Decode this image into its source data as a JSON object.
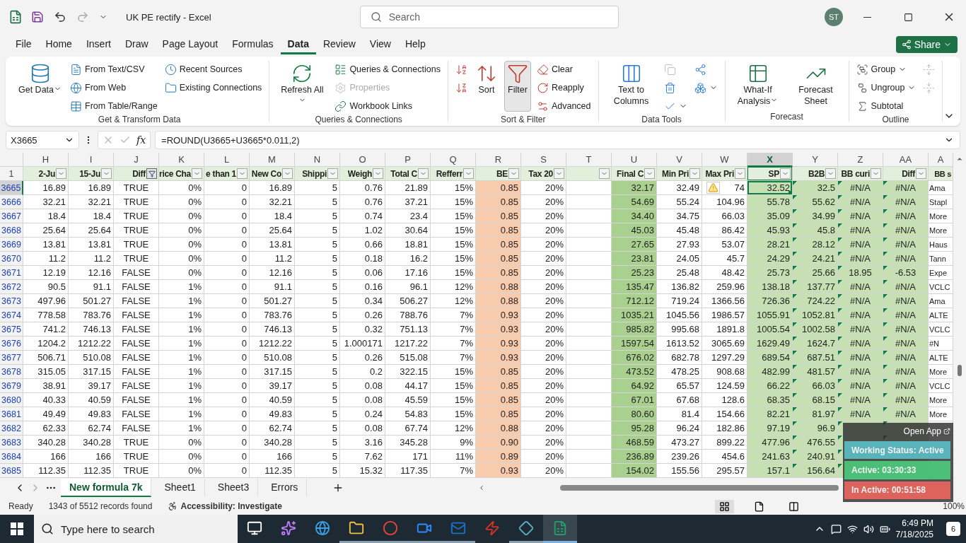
{
  "title_bar": {
    "document_title": "UK PE rectify  -  Excel",
    "search_placeholder": "Search",
    "avatar": "ST"
  },
  "menu_tabs": [
    {
      "label": "File",
      "selected": false
    },
    {
      "label": "Home",
      "selected": false
    },
    {
      "label": "Insert",
      "selected": false
    },
    {
      "label": "Draw",
      "selected": false
    },
    {
      "label": "Page Layout",
      "selected": false
    },
    {
      "label": "Formulas",
      "selected": false
    },
    {
      "label": "Data",
      "selected": true
    },
    {
      "label": "Review",
      "selected": false
    },
    {
      "label": "View",
      "selected": false
    },
    {
      "label": "Help",
      "selected": false
    }
  ],
  "share_button": "Share",
  "ribbon": [
    {
      "label": "Get & Transform Data",
      "columns": [
        {
          "kind": "large",
          "label": "Get Data",
          "menu": true
        },
        {
          "kind": "stack",
          "items": [
            {
              "label": "From Text/CSV",
              "disabled": false
            },
            {
              "label": "From Web",
              "disabled": false
            },
            {
              "label": "From Table/Range",
              "disabled": false
            }
          ]
        },
        {
          "kind": "stack",
          "items": [
            {
              "label": "Recent Sources",
              "disabled": false
            },
            {
              "label": "Existing Connections",
              "disabled": false
            }
          ]
        }
      ]
    },
    {
      "label": "Queries & Connections",
      "columns": [
        {
          "kind": "large",
          "label": "Refresh All",
          "menu": true
        },
        {
          "kind": "stack",
          "items": [
            {
              "label": "Queries & Connections",
              "disabled": false
            },
            {
              "label": "Properties",
              "disabled": true
            },
            {
              "label": "Workbook Links",
              "disabled": false
            }
          ]
        }
      ]
    },
    {
      "label": "Sort & Filter",
      "columns": [
        {
          "kind": "stack",
          "items": [
            {
              "disabled": false
            },
            {
              "disabled": false
            }
          ]
        },
        {
          "kind": "large",
          "label": "Sort",
          "menu": false
        },
        {
          "kind": "large",
          "label": "Filter",
          "menu": false,
          "selected": true
        },
        {
          "kind": "stack",
          "items": [
            {
              "label": "Clear",
              "disabled": false
            },
            {
              "label": "Reapply",
              "disabled": false
            },
            {
              "label": "Advanced",
              "disabled": false
            }
          ]
        }
      ]
    },
    {
      "label": "Data Tools",
      "columns": [
        {
          "kind": "large",
          "label": "Text to Columns",
          "menu": false
        },
        {
          "kind": "stack",
          "items": [
            {
              "disabled": true
            },
            {
              "disabled": false
            },
            {
              "disabled": false,
              "menu": true
            }
          ]
        },
        {
          "kind": "stack",
          "items": [
            {
              "disabled": false
            },
            {
              "disabled": false,
              "menu": true
            }
          ]
        }
      ]
    },
    {
      "label": "Forecast",
      "columns": [
        {
          "kind": "large",
          "label": "What-If Analysis",
          "menu": true
        },
        {
          "kind": "large",
          "label": "Forecast Sheet",
          "menu": false
        }
      ]
    },
    {
      "label": "Outline",
      "columns": [
        {
          "kind": "stack",
          "items": [
            {
              "label": "Group",
              "disabled": false,
              "menu": true
            },
            {
              "label": "Ungroup",
              "disabled": false,
              "menu": true
            },
            {
              "label": "Subtotal",
              "disabled": false
            }
          ]
        },
        {
          "kind": "stack",
          "items": [
            {
              "disabled": true
            },
            {
              "disabled": true
            }
          ]
        }
      ]
    }
  ],
  "formula_bar": {
    "name_box": "X3665",
    "fx": "fx",
    "formula": "=ROUND(U3665+U3665*0.011,2)"
  },
  "sheet": {
    "header_row_number": "1",
    "error_check_tag": true,
    "columns": [
      {
        "letter": "H",
        "header": "2-Ju",
        "kind": "number",
        "selected": false,
        "filtered": false
      },
      {
        "letter": "I",
        "header": "15-Ju",
        "kind": "number",
        "selected": false,
        "filtered": false
      },
      {
        "letter": "J",
        "header": "Diff",
        "kind": "boolean",
        "selected": false,
        "filtered": true
      },
      {
        "letter": "K",
        "header": "rice Cha",
        "kind": "number",
        "selected": false,
        "filtered": false
      },
      {
        "letter": "L",
        "header": "e than 1",
        "kind": "number",
        "selected": false,
        "filtered": false
      },
      {
        "letter": "M",
        "header": "New Co",
        "kind": "number",
        "selected": false,
        "filtered": false
      },
      {
        "letter": "N",
        "header": "Shippi",
        "kind": "number",
        "selected": false,
        "filtered": false
      },
      {
        "letter": "O",
        "header": "Weigh",
        "kind": "number",
        "selected": false,
        "filtered": false
      },
      {
        "letter": "P",
        "header": "Total C",
        "kind": "number",
        "selected": false,
        "filtered": false
      },
      {
        "letter": "Q",
        "header": "Refferr",
        "kind": "number",
        "selected": false,
        "filtered": false
      },
      {
        "letter": "R",
        "header": "BE",
        "kind": "number",
        "selected": false,
        "filtered": false,
        "color": "#f8cbad"
      },
      {
        "letter": "S",
        "header": "Tax 20",
        "kind": "number",
        "selected": false,
        "filtered": false
      },
      {
        "letter": "T",
        "kind": "number",
        "selected": false,
        "filtered": false
      },
      {
        "letter": "U",
        "header": "Final C",
        "kind": "number",
        "selected": false,
        "filtered": false,
        "color": "#a9d08e"
      },
      {
        "letter": "V",
        "header": "Min Pri",
        "kind": "number",
        "selected": false,
        "filtered": false
      },
      {
        "letter": "W",
        "header": "Max Pri",
        "kind": "number",
        "selected": false,
        "filtered": false
      },
      {
        "letter": "X",
        "header": "SP",
        "kind": "number",
        "selected": true,
        "filtered": false,
        "color": "#c6e0b4"
      },
      {
        "letter": "Y",
        "header": "B2B",
        "kind": "number",
        "selected": false,
        "filtered": false,
        "color": "#c6e0b4",
        "error_indicator": true
      },
      {
        "letter": "Z",
        "header": "BB curi",
        "kind": "lookup",
        "selected": false,
        "filtered": false,
        "color": "#c6e0b4",
        "error_indicator": true
      },
      {
        "letter": "AA",
        "header": "Diff",
        "kind": "lookup",
        "selected": false,
        "filtered": false,
        "color": "#c6e0b4",
        "error_indicator": true
      },
      {
        "letter": "A",
        "header": "BB s",
        "kind": "text",
        "selected": false
      }
    ],
    "rows": [
      {
        "number": "3665",
        "selected": true,
        "cells": [
          "16.89",
          "16.89",
          "TRUE",
          "0%",
          "0",
          "16.89",
          "5",
          "0.76",
          "21.89",
          "15%",
          "0.85",
          "20%",
          null,
          "32.17",
          "32.49",
          "74",
          "32.52",
          "32.5",
          "#N/A",
          "#N/A",
          "Ama"
        ]
      },
      {
        "number": "3666",
        "selected": false,
        "cells": [
          "32.21",
          "32.21",
          "TRUE",
          "0%",
          "0",
          "32.21",
          "5",
          "0.76",
          "37.21",
          "15%",
          "0.85",
          "20%",
          null,
          "54.69",
          "55.24",
          "104.96",
          "55.78",
          "55.62",
          "#N/A",
          "#N/A",
          "Stapl"
        ]
      },
      {
        "number": "3667",
        "selected": false,
        "cells": [
          "18.4",
          "18.4",
          "TRUE",
          "0%",
          "0",
          "18.4",
          "5",
          "0.74",
          "23.4",
          "15%",
          "0.85",
          "20%",
          null,
          "34.40",
          "34.75",
          "66.03",
          "35.09",
          "34.99",
          "#N/A",
          "#N/A",
          "More"
        ]
      },
      {
        "number": "3668",
        "selected": false,
        "cells": [
          "25.64",
          "25.64",
          "TRUE",
          "0%",
          "0",
          "25.64",
          "5",
          "1.02",
          "30.64",
          "15%",
          "0.85",
          "20%",
          null,
          "45.03",
          "45.48",
          "86.42",
          "45.93",
          "45.8",
          "#N/A",
          "#N/A",
          "More"
        ]
      },
      {
        "number": "3669",
        "selected": false,
        "cells": [
          "13.81",
          "13.81",
          "TRUE",
          "0%",
          "0",
          "13.81",
          "5",
          "0.66",
          "18.81",
          "15%",
          "0.85",
          "20%",
          null,
          "27.65",
          "27.93",
          "53.07",
          "28.21",
          "28.12",
          "#N/A",
          "#N/A",
          "Haus"
        ]
      },
      {
        "number": "3670",
        "selected": false,
        "cells": [
          "11.2",
          "11.2",
          "TRUE",
          "0%",
          "0",
          "11.2",
          "5",
          "0.18",
          "16.2",
          "15%",
          "0.85",
          "20%",
          null,
          "23.81",
          "24.05",
          "45.7",
          "24.29",
          "24.21",
          "#N/A",
          "#N/A",
          "Tann"
        ]
      },
      {
        "number": "3671",
        "selected": false,
        "cells": [
          "12.19",
          "12.16",
          "FALSE",
          "0%",
          "0",
          "12.16",
          "5",
          "0.06",
          "17.16",
          "15%",
          "0.85",
          "20%",
          null,
          "25.23",
          "25.48",
          "48.42",
          "25.73",
          "25.66",
          "18.95",
          "-6.53",
          "Expe"
        ]
      },
      {
        "number": "3672",
        "selected": false,
        "cells": [
          "90.5",
          "91.1",
          "FALSE",
          "1%",
          "0",
          "91.1",
          "5",
          "0.16",
          "96.1",
          "12%",
          "0.88",
          "20%",
          null,
          "135.47",
          "136.82",
          "259.96",
          "138.18",
          "137.77",
          "#N/A",
          "#N/A",
          "VCLC"
        ]
      },
      {
        "number": "3673",
        "selected": false,
        "cells": [
          "497.96",
          "501.27",
          "FALSE",
          "1%",
          "0",
          "501.27",
          "5",
          "0.34",
          "506.27",
          "12%",
          "0.88",
          "20%",
          null,
          "712.12",
          "719.24",
          "1366.56",
          "726.36",
          "724.22",
          "#N/A",
          "#N/A",
          "Ama"
        ]
      },
      {
        "number": "3674",
        "selected": false,
        "cells": [
          "778.58",
          "783.76",
          "FALSE",
          "1%",
          "0",
          "783.76",
          "5",
          "0.26",
          "788.76",
          "7%",
          "0.93",
          "20%",
          null,
          "1035.21",
          "1045.56",
          "1986.57",
          "1055.91",
          "1052.81",
          "#N/A",
          "#N/A",
          "ALTE"
        ]
      },
      {
        "number": "3675",
        "selected": false,
        "cells": [
          "741.2",
          "746.13",
          "FALSE",
          "1%",
          "0",
          "746.13",
          "5",
          "0.32",
          "751.13",
          "7%",
          "0.93",
          "20%",
          null,
          "985.82",
          "995.68",
          "1891.8",
          "1005.54",
          "1002.58",
          "#N/A",
          "#N/A",
          "VCLC"
        ]
      },
      {
        "number": "3676",
        "selected": false,
        "cells": [
          "1204.2",
          "1212.22",
          "FALSE",
          "1%",
          "0",
          "1212.22",
          "5",
          "1.000171",
          "1217.22",
          "7%",
          "0.93",
          "20%",
          null,
          "1597.54",
          "1613.52",
          "3065.69",
          "1629.49",
          "1624.7",
          "#N/A",
          "#N/A",
          "#N"
        ]
      },
      {
        "number": "3677",
        "selected": false,
        "cells": [
          "506.71",
          "510.08",
          "FALSE",
          "1%",
          "0",
          "510.08",
          "5",
          "0.26",
          "515.08",
          "7%",
          "0.93",
          "20%",
          null,
          "676.02",
          "682.78",
          "1297.29",
          "689.54",
          "687.51",
          "#N/A",
          "#N/A",
          "ALTE"
        ]
      },
      {
        "number": "3678",
        "selected": false,
        "cells": [
          "315.05",
          "317.15",
          "FALSE",
          "1%",
          "0",
          "317.15",
          "5",
          "0.2",
          "322.15",
          "15%",
          "0.85",
          "20%",
          null,
          "473.52",
          "478.25",
          "908.68",
          "482.99",
          "481.57",
          "#N/A",
          "#N/A",
          "More"
        ]
      },
      {
        "number": "3679",
        "selected": false,
        "cells": [
          "38.91",
          "39.17",
          "FALSE",
          "1%",
          "0",
          "39.17",
          "5",
          "0.08",
          "44.17",
          "15%",
          "0.85",
          "20%",
          null,
          "64.92",
          "65.57",
          "124.59",
          "66.22",
          "66.03",
          "#N/A",
          "#N/A",
          "VCLC"
        ]
      },
      {
        "number": "3680",
        "selected": false,
        "cells": [
          "40.33",
          "40.59",
          "FALSE",
          "1%",
          "0",
          "40.59",
          "5",
          "0.08",
          "45.59",
          "15%",
          "0.85",
          "20%",
          null,
          "67.01",
          "67.68",
          "128.6",
          "68.35",
          "68.15",
          "#N/A",
          "#N/A",
          "More"
        ]
      },
      {
        "number": "3681",
        "selected": false,
        "cells": [
          "49.49",
          "49.83",
          "FALSE",
          "1%",
          "0",
          "49.83",
          "5",
          "0.24",
          "54.83",
          "15%",
          "0.85",
          "20%",
          null,
          "80.60",
          "81.4",
          "154.66",
          "82.21",
          "81.97",
          "#N/A",
          "#N/A",
          "More"
        ]
      },
      {
        "number": "3682",
        "selected": false,
        "cells": [
          "62.33",
          "62.74",
          "FALSE",
          "1%",
          "0",
          "62.74",
          "5",
          "0.08",
          "67.74",
          "12%",
          "0.88",
          "20%",
          null,
          "95.28",
          "96.24",
          "182.86",
          "97.19",
          "96.9",
          null,
          null,
          null
        ]
      },
      {
        "number": "3683",
        "selected": false,
        "cells": [
          "340.28",
          "340.28",
          "TRUE",
          "0%",
          "0",
          "340.28",
          "5",
          "3.16",
          "345.28",
          "9%",
          "0.90",
          "20%",
          null,
          "468.59",
          "473.27",
          "899.22",
          "477.96",
          "476.55",
          null,
          null,
          null
        ]
      },
      {
        "number": "3684",
        "selected": false,
        "cells": [
          "166",
          "166",
          "TRUE",
          "0%",
          "0",
          "166",
          "5",
          "7.62",
          "171",
          "11%",
          "0.89",
          "20%",
          null,
          "236.89",
          "239.26",
          "454.6",
          "241.63",
          "240.91",
          null,
          null,
          null
        ]
      },
      {
        "number": "3685",
        "selected": false,
        "cells": [
          "112.35",
          "112.35",
          "TRUE",
          "0%",
          "0",
          "112.35",
          "5",
          "15.32",
          "117.35",
          "7%",
          "0.93",
          "20%",
          null,
          "154.02",
          "155.56",
          "295.57",
          "157.1",
          "156.64",
          null,
          null,
          null
        ]
      }
    ]
  },
  "sheet_tabs": [
    {
      "label": "New formula 7k",
      "selected": true
    },
    {
      "label": "Sheet1",
      "selected": false
    },
    {
      "label": "Sheet3",
      "selected": false
    },
    {
      "label": "Errors",
      "selected": false
    }
  ],
  "status_bar": {
    "mode": "Ready",
    "records": "1343 of 5512 records found",
    "accessibility": "Accessibility: Investigate",
    "zoom": "100%",
    "views": [
      {
        "selected": true
      },
      {
        "selected": false
      },
      {
        "selected": false
      }
    ]
  },
  "time_tracker": {
    "link": "Open App",
    "status": "Working Status: Active",
    "active": "Active: 03:30:33",
    "inactive": "In Active: 00:51:58"
  },
  "taskbar": {
    "search_placeholder": "Type here to search",
    "apps": [
      {
        "open": false,
        "selected": false
      },
      {
        "open": false,
        "selected": false
      },
      {
        "open": false,
        "selected": false
      },
      {
        "open": true,
        "selected": false
      },
      {
        "open": true,
        "selected": false
      },
      {
        "open": true,
        "selected": false
      },
      {
        "open": true,
        "selected": false
      },
      {
        "open": false,
        "selected": false
      },
      {
        "open": true,
        "selected": false
      },
      {
        "open": true,
        "selected": true
      }
    ],
    "time": "6:49 PM",
    "date": "7/18/2025",
    "notifications": "6"
  }
}
